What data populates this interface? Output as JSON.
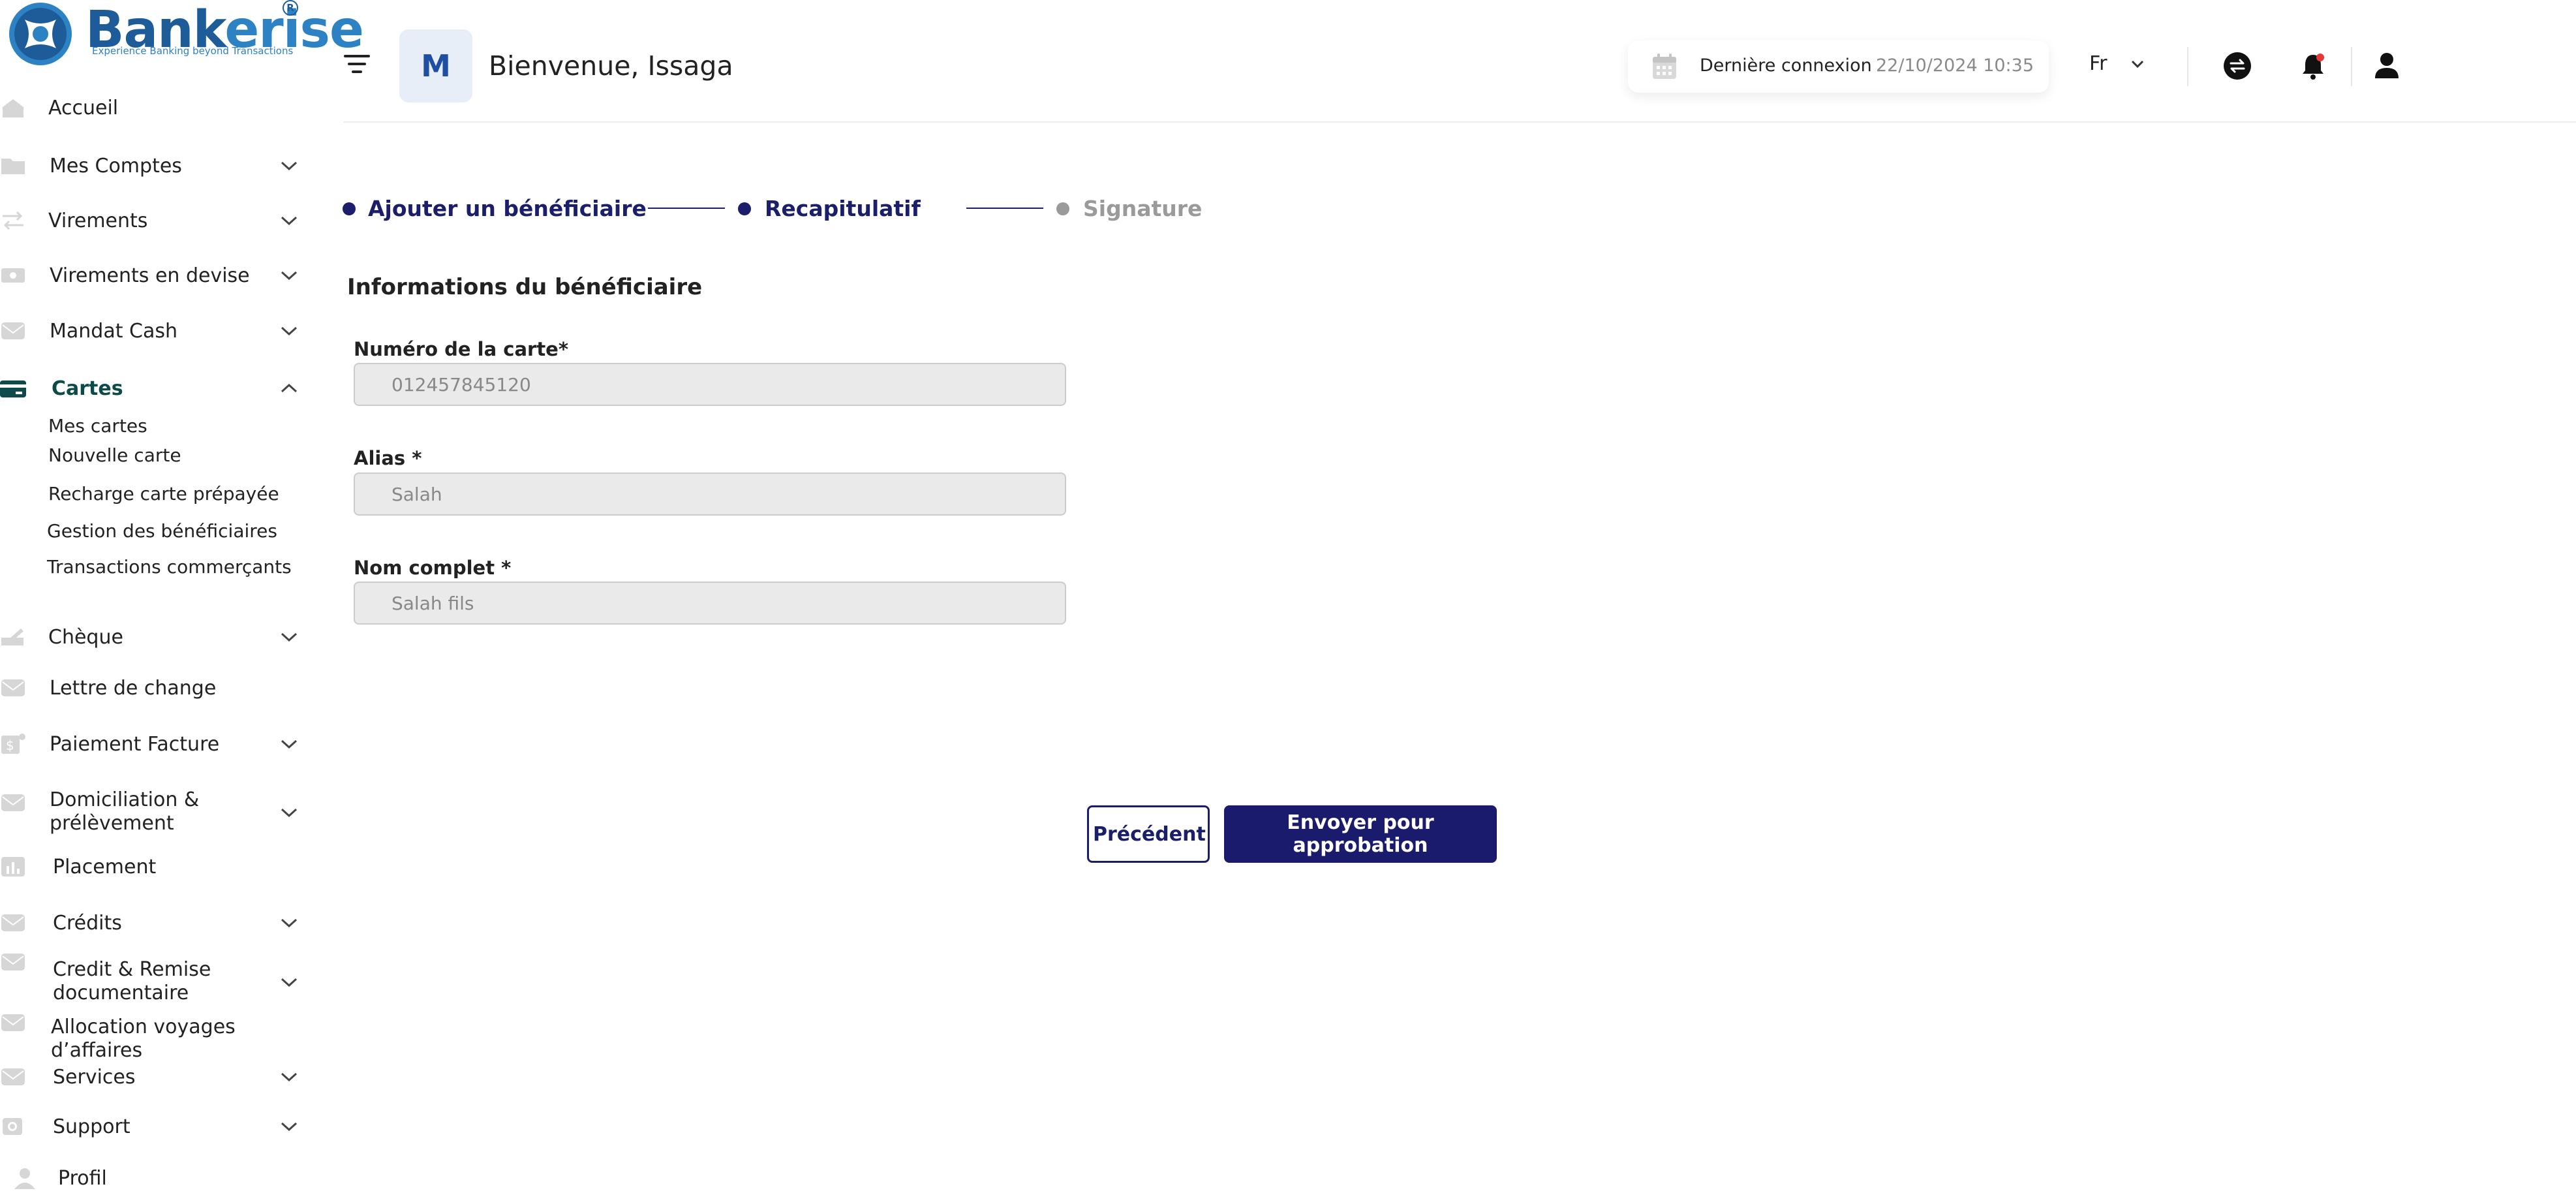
{
  "brand": {
    "name_part1": "Bank",
    "name_part2": "erise",
    "tagline": "Experience Banking beyond Transactions",
    "registered": "R"
  },
  "sidebar": {
    "items": [
      {
        "label": "Accueil"
      },
      {
        "label": "Mes Comptes"
      },
      {
        "label": "Virements"
      },
      {
        "label": "Virements en devise"
      },
      {
        "label": "Mandat Cash"
      },
      {
        "label": "Cartes"
      },
      {
        "label": "Chèque"
      },
      {
        "label": "Lettre de change"
      },
      {
        "label": "Paiement Facture"
      },
      {
        "label_line1": "Domiciliation &",
        "label_line2": "prélèvement"
      },
      {
        "label": "Placement"
      },
      {
        "label": "Crédits"
      },
      {
        "label_line1": "Credit & Remise",
        "label_line2": "documentaire"
      },
      {
        "label_line1": "Allocation  voyages",
        "label_line2": "d’affaires"
      },
      {
        "label": "Services"
      },
      {
        "label": "Support"
      },
      {
        "label": "Profil"
      }
    ],
    "cartes_sub": [
      {
        "label": "Mes cartes"
      },
      {
        "label": "Nouvelle carte"
      },
      {
        "label": "Recharge carte prépayée"
      },
      {
        "label": "Gestion des bénéficiaires"
      },
      {
        "label": "Transactions commerçants"
      }
    ]
  },
  "header": {
    "avatar_initial": "M",
    "welcome": "Bienvenue, Issaga",
    "last_login_label": "Dernière  connexion",
    "last_login_date": "22/10/2024 10:35",
    "language": "Fr"
  },
  "stepper": {
    "steps": [
      {
        "label": "Ajouter un bénéficiaire",
        "state": "done"
      },
      {
        "label": "Recapitulatif",
        "state": "active"
      },
      {
        "label": "Signature",
        "state": "pending"
      }
    ]
  },
  "form": {
    "section_title": "Informations du bénéficiaire",
    "fields": [
      {
        "label": "Numéro de la carte*",
        "value": "012457845120"
      },
      {
        "label": "Alias *",
        "value": "Salah"
      },
      {
        "label": "Nom complet *",
        "value": "Salah fils"
      }
    ]
  },
  "actions": {
    "previous": "Précédent",
    "submit": "Envoyer pour approbation"
  },
  "colors": {
    "primary": "#1b1b6e",
    "active_nav": "#0d4a4a",
    "brand_blue": "#1e5c99",
    "notification": "#e53935"
  }
}
